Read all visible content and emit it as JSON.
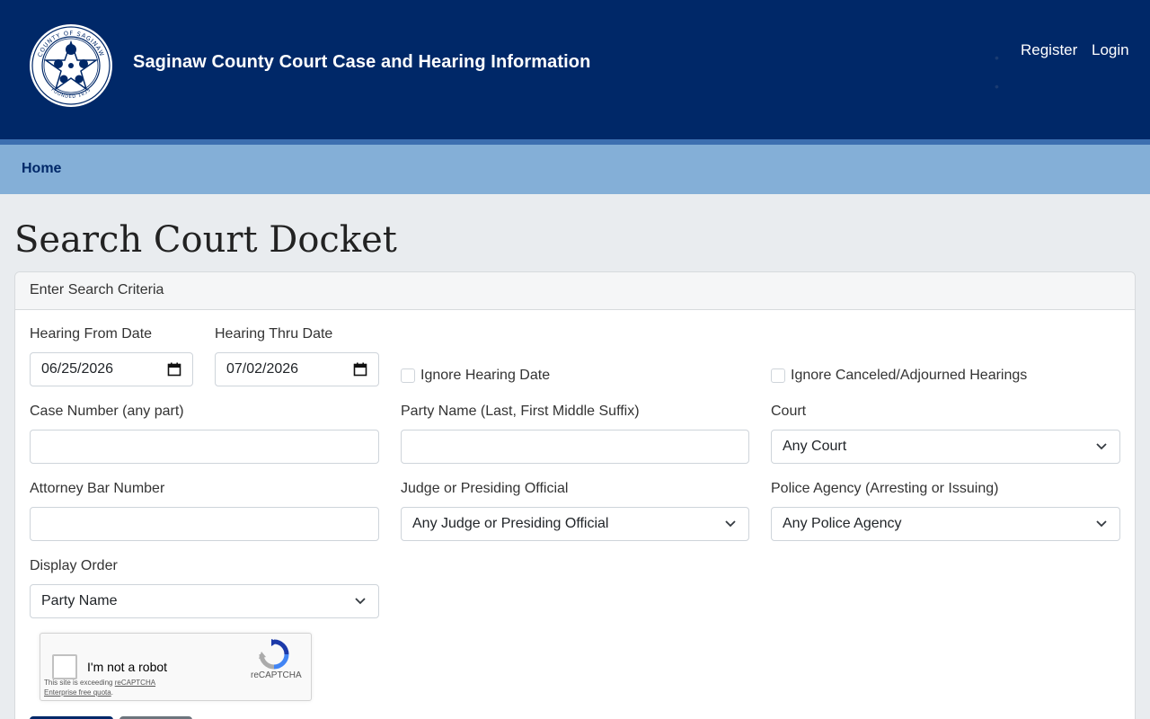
{
  "header": {
    "site_title": "Saginaw County Court Case and Hearing Information",
    "seal_text_top": "COUNTY OF SAGINAW",
    "seal_text_bottom": "FOUNDED 1835",
    "register_label": "Register",
    "login_label": "Login",
    "bg_color": "#002868"
  },
  "nav": {
    "home_label": "Home",
    "bg_color": "#84afd7"
  },
  "page": {
    "title": "Search Court Docket"
  },
  "form": {
    "card_header": "Enter Search Criteria",
    "hearing_from": {
      "label": "Hearing From Date",
      "value": "06/25/2026"
    },
    "hearing_thru": {
      "label": "Hearing Thru Date",
      "value": "07/02/2026"
    },
    "ignore_hearing_date": {
      "label": "Ignore Hearing Date",
      "checked": false
    },
    "ignore_canceled": {
      "label": "Ignore Canceled/Adjourned Hearings",
      "checked": false
    },
    "case_number": {
      "label": "Case Number (any part)",
      "value": "",
      "placeholder": ""
    },
    "party_name": {
      "label": "Party Name (Last, First Middle Suffix)",
      "value": "",
      "placeholder": ""
    },
    "court": {
      "label": "Court",
      "value": "Any Court"
    },
    "attorney_bar": {
      "label": "Attorney Bar Number",
      "value": "",
      "placeholder": ""
    },
    "judge": {
      "label": "Judge or Presiding Official",
      "value": "Any Judge or Presiding Official"
    },
    "police_agency": {
      "label": "Police Agency (Arresting or Issuing)",
      "value": "Any Police Agency"
    },
    "display_order": {
      "label": "Display Order",
      "value": "Party Name"
    }
  },
  "recaptcha": {
    "label": "I'm not a robot",
    "brand": "reCAPTCHA",
    "note_prefix": "This site is exceeding",
    "note_link1": "reCAPTCHA",
    "note_link2": "Enterprise free quota",
    "note_suffix": "."
  }
}
